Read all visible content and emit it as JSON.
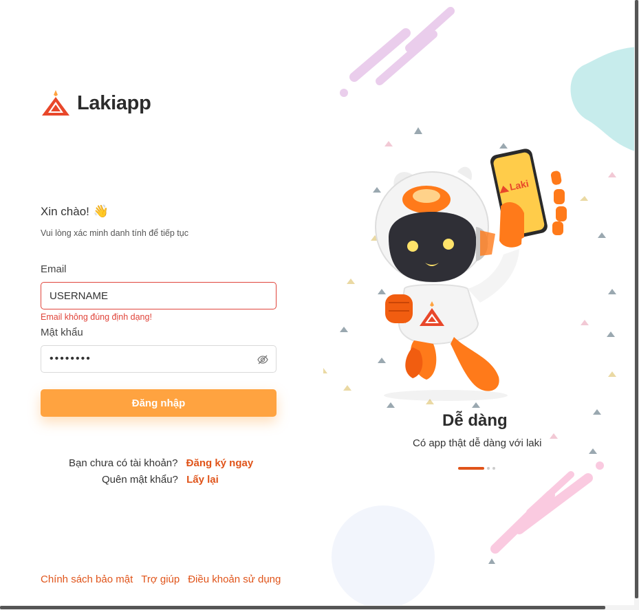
{
  "brand": {
    "name": "Lakiapp",
    "accent": "#e0541a",
    "button_color": "#ffa340",
    "error_color": "#e0443a"
  },
  "login": {
    "greeting": "Xin chào!",
    "greeting_icon": "waving-hand-icon",
    "subtitle": "Vui lòng xác minh danh tính để tiếp tục",
    "email_label": "Email",
    "email_value": "USERNAME",
    "email_error": "Email không đúng định dạng!",
    "password_label": "Mật khẩu",
    "password_value": "••••••••",
    "submit_label": "Đăng nhập",
    "signup_prompt": "Bạn chưa có tài khoản?",
    "signup_link": "Đăng ký ngay",
    "forgot_prompt": "Quên mật khẩu?",
    "forgot_link": "Lấy lại"
  },
  "footer": {
    "privacy": "Chính sách bảo mật",
    "help": "Trợ giúp",
    "terms": "Điều khoản sử dụng"
  },
  "carousel": {
    "title": "Dễ dàng",
    "subtitle": "Có app thật dễ dàng với laki",
    "phone_text": "Laki",
    "slide_count": 3,
    "active_index": 0
  }
}
